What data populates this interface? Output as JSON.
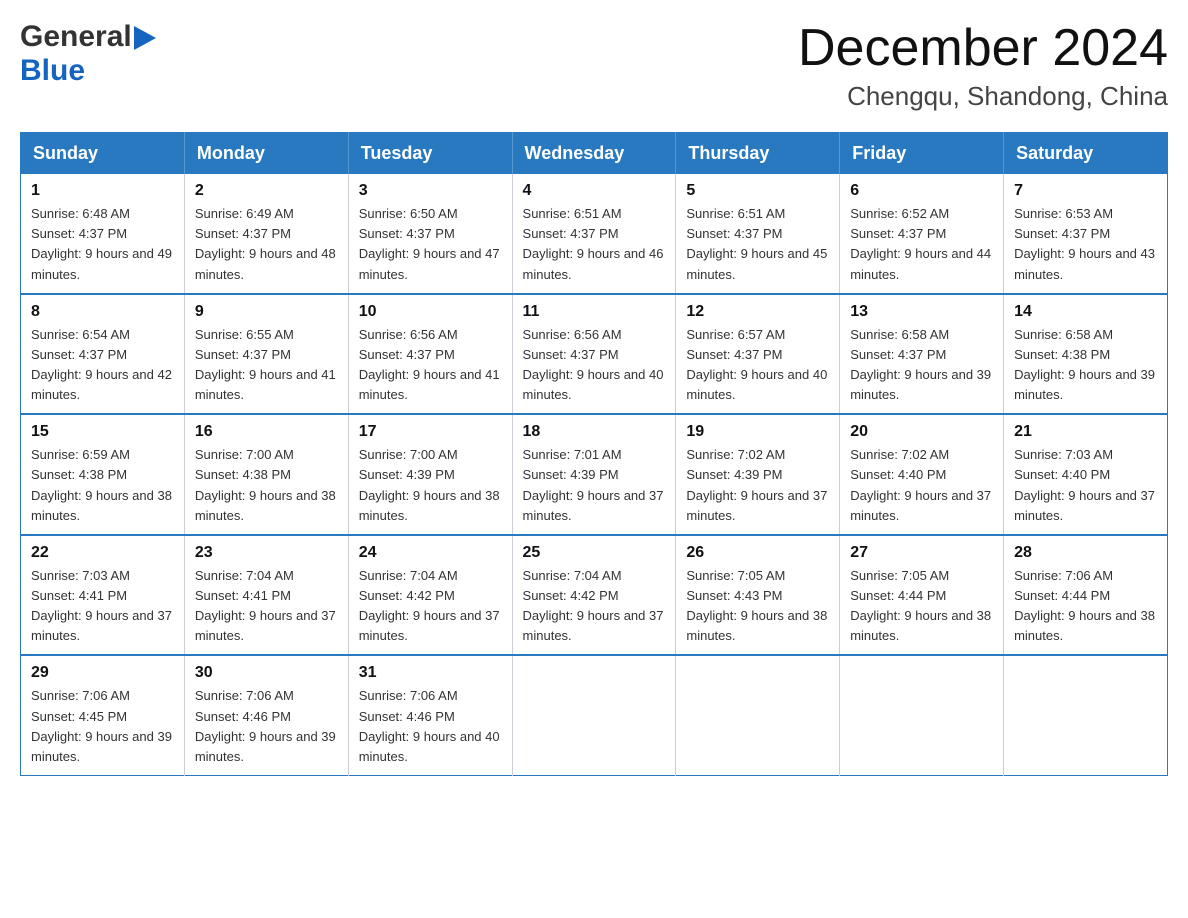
{
  "header": {
    "logo": {
      "general": "General",
      "blue": "Blue"
    },
    "title": "December 2024",
    "location": "Chengqu, Shandong, China"
  },
  "days_of_week": [
    "Sunday",
    "Monday",
    "Tuesday",
    "Wednesday",
    "Thursday",
    "Friday",
    "Saturday"
  ],
  "weeks": [
    [
      {
        "day": "1",
        "sunrise": "Sunrise: 6:48 AM",
        "sunset": "Sunset: 4:37 PM",
        "daylight": "Daylight: 9 hours and 49 minutes."
      },
      {
        "day": "2",
        "sunrise": "Sunrise: 6:49 AM",
        "sunset": "Sunset: 4:37 PM",
        "daylight": "Daylight: 9 hours and 48 minutes."
      },
      {
        "day": "3",
        "sunrise": "Sunrise: 6:50 AM",
        "sunset": "Sunset: 4:37 PM",
        "daylight": "Daylight: 9 hours and 47 minutes."
      },
      {
        "day": "4",
        "sunrise": "Sunrise: 6:51 AM",
        "sunset": "Sunset: 4:37 PM",
        "daylight": "Daylight: 9 hours and 46 minutes."
      },
      {
        "day": "5",
        "sunrise": "Sunrise: 6:51 AM",
        "sunset": "Sunset: 4:37 PM",
        "daylight": "Daylight: 9 hours and 45 minutes."
      },
      {
        "day": "6",
        "sunrise": "Sunrise: 6:52 AM",
        "sunset": "Sunset: 4:37 PM",
        "daylight": "Daylight: 9 hours and 44 minutes."
      },
      {
        "day": "7",
        "sunrise": "Sunrise: 6:53 AM",
        "sunset": "Sunset: 4:37 PM",
        "daylight": "Daylight: 9 hours and 43 minutes."
      }
    ],
    [
      {
        "day": "8",
        "sunrise": "Sunrise: 6:54 AM",
        "sunset": "Sunset: 4:37 PM",
        "daylight": "Daylight: 9 hours and 42 minutes."
      },
      {
        "day": "9",
        "sunrise": "Sunrise: 6:55 AM",
        "sunset": "Sunset: 4:37 PM",
        "daylight": "Daylight: 9 hours and 41 minutes."
      },
      {
        "day": "10",
        "sunrise": "Sunrise: 6:56 AM",
        "sunset": "Sunset: 4:37 PM",
        "daylight": "Daylight: 9 hours and 41 minutes."
      },
      {
        "day": "11",
        "sunrise": "Sunrise: 6:56 AM",
        "sunset": "Sunset: 4:37 PM",
        "daylight": "Daylight: 9 hours and 40 minutes."
      },
      {
        "day": "12",
        "sunrise": "Sunrise: 6:57 AM",
        "sunset": "Sunset: 4:37 PM",
        "daylight": "Daylight: 9 hours and 40 minutes."
      },
      {
        "day": "13",
        "sunrise": "Sunrise: 6:58 AM",
        "sunset": "Sunset: 4:37 PM",
        "daylight": "Daylight: 9 hours and 39 minutes."
      },
      {
        "day": "14",
        "sunrise": "Sunrise: 6:58 AM",
        "sunset": "Sunset: 4:38 PM",
        "daylight": "Daylight: 9 hours and 39 minutes."
      }
    ],
    [
      {
        "day": "15",
        "sunrise": "Sunrise: 6:59 AM",
        "sunset": "Sunset: 4:38 PM",
        "daylight": "Daylight: 9 hours and 38 minutes."
      },
      {
        "day": "16",
        "sunrise": "Sunrise: 7:00 AM",
        "sunset": "Sunset: 4:38 PM",
        "daylight": "Daylight: 9 hours and 38 minutes."
      },
      {
        "day": "17",
        "sunrise": "Sunrise: 7:00 AM",
        "sunset": "Sunset: 4:39 PM",
        "daylight": "Daylight: 9 hours and 38 minutes."
      },
      {
        "day": "18",
        "sunrise": "Sunrise: 7:01 AM",
        "sunset": "Sunset: 4:39 PM",
        "daylight": "Daylight: 9 hours and 37 minutes."
      },
      {
        "day": "19",
        "sunrise": "Sunrise: 7:02 AM",
        "sunset": "Sunset: 4:39 PM",
        "daylight": "Daylight: 9 hours and 37 minutes."
      },
      {
        "day": "20",
        "sunrise": "Sunrise: 7:02 AM",
        "sunset": "Sunset: 4:40 PM",
        "daylight": "Daylight: 9 hours and 37 minutes."
      },
      {
        "day": "21",
        "sunrise": "Sunrise: 7:03 AM",
        "sunset": "Sunset: 4:40 PM",
        "daylight": "Daylight: 9 hours and 37 minutes."
      }
    ],
    [
      {
        "day": "22",
        "sunrise": "Sunrise: 7:03 AM",
        "sunset": "Sunset: 4:41 PM",
        "daylight": "Daylight: 9 hours and 37 minutes."
      },
      {
        "day": "23",
        "sunrise": "Sunrise: 7:04 AM",
        "sunset": "Sunset: 4:41 PM",
        "daylight": "Daylight: 9 hours and 37 minutes."
      },
      {
        "day": "24",
        "sunrise": "Sunrise: 7:04 AM",
        "sunset": "Sunset: 4:42 PM",
        "daylight": "Daylight: 9 hours and 37 minutes."
      },
      {
        "day": "25",
        "sunrise": "Sunrise: 7:04 AM",
        "sunset": "Sunset: 4:42 PM",
        "daylight": "Daylight: 9 hours and 37 minutes."
      },
      {
        "day": "26",
        "sunrise": "Sunrise: 7:05 AM",
        "sunset": "Sunset: 4:43 PM",
        "daylight": "Daylight: 9 hours and 38 minutes."
      },
      {
        "day": "27",
        "sunrise": "Sunrise: 7:05 AM",
        "sunset": "Sunset: 4:44 PM",
        "daylight": "Daylight: 9 hours and 38 minutes."
      },
      {
        "day": "28",
        "sunrise": "Sunrise: 7:06 AM",
        "sunset": "Sunset: 4:44 PM",
        "daylight": "Daylight: 9 hours and 38 minutes."
      }
    ],
    [
      {
        "day": "29",
        "sunrise": "Sunrise: 7:06 AM",
        "sunset": "Sunset: 4:45 PM",
        "daylight": "Daylight: 9 hours and 39 minutes."
      },
      {
        "day": "30",
        "sunrise": "Sunrise: 7:06 AM",
        "sunset": "Sunset: 4:46 PM",
        "daylight": "Daylight: 9 hours and 39 minutes."
      },
      {
        "day": "31",
        "sunrise": "Sunrise: 7:06 AM",
        "sunset": "Sunset: 4:46 PM",
        "daylight": "Daylight: 9 hours and 40 minutes."
      },
      null,
      null,
      null,
      null
    ]
  ]
}
